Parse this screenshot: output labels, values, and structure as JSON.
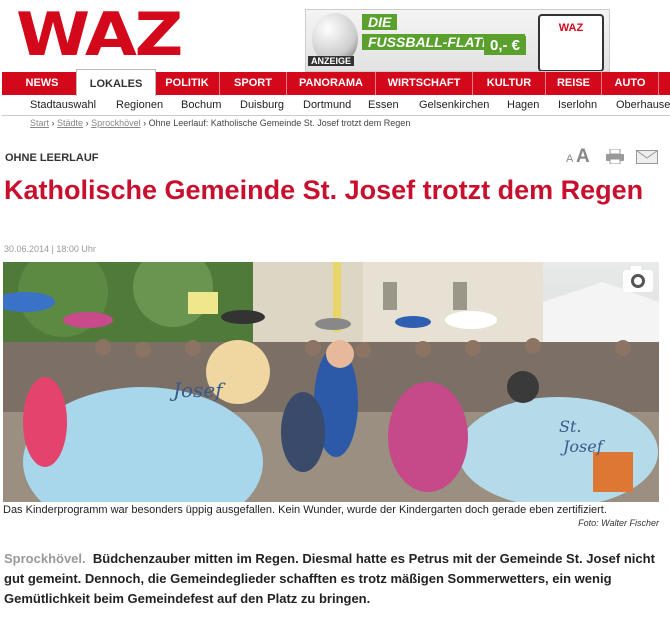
{
  "brand": {
    "logo": "WAZ",
    "color": "#d4081b"
  },
  "ad": {
    "badge": "ANZEIGE",
    "line1": "DIE",
    "line2": "FUSSBALL-",
    "line3": "FLATRATE",
    "price": "0,- €",
    "phone_brand": "WAZ"
  },
  "nav": {
    "items": [
      {
        "label": "NEWS"
      },
      {
        "label": "LOKALES",
        "active": true
      },
      {
        "label": "POLITIK"
      },
      {
        "label": "SPORT"
      },
      {
        "label": "PANORAMA"
      },
      {
        "label": "WIRTSCHAFT"
      },
      {
        "label": "KULTUR"
      },
      {
        "label": "REISE"
      },
      {
        "label": "AUTO"
      }
    ]
  },
  "subnav": {
    "items": [
      "Stadtauswahl",
      "Regionen",
      "Bochum",
      "Duisburg",
      "Dortmund",
      "Essen",
      "Gelsenkirchen",
      "Hagen",
      "Iserlohn",
      "Oberhausen"
    ]
  },
  "breadcrumb": {
    "start": "Start",
    "staedte": "Städte",
    "city": "Sprockhövel",
    "current": "Ohne Leerlauf: Katholische Gemeinde St. Josef trotzt dem Regen",
    "sep": "›"
  },
  "article": {
    "kicker": "OHNE LEERLAUF",
    "title": "Katholische Gemeinde St. Josef trotzt dem Regen",
    "date": "30.06.2014 | 18:00 Uhr",
    "caption": "Das Kinderprogramm war besonders üppig ausgefallen. Kein Wunder, wurde der Kindergarten doch gerade eben zertifiziert.",
    "credit": "Foto: Walter Fischer",
    "location": "Sprockhövel.",
    "lead": "Büdchenzauber mitten im Regen. Diesmal hatte es Petrus mit der Gemeinde St. Josef nicht gut gemeint. Dennoch, die Gemeindeglieder schafften es trotz mäßigen Sommerwetters, ein wenig Gemütlichkeit beim Gemeindefest auf den Platz zu bringen."
  },
  "tools": {
    "font_small": "A",
    "font_large": "A"
  },
  "photo": {
    "shirt_text_left": "Josef",
    "shirt_text_right_1": "St.",
    "shirt_text_right_2": "Josef"
  }
}
